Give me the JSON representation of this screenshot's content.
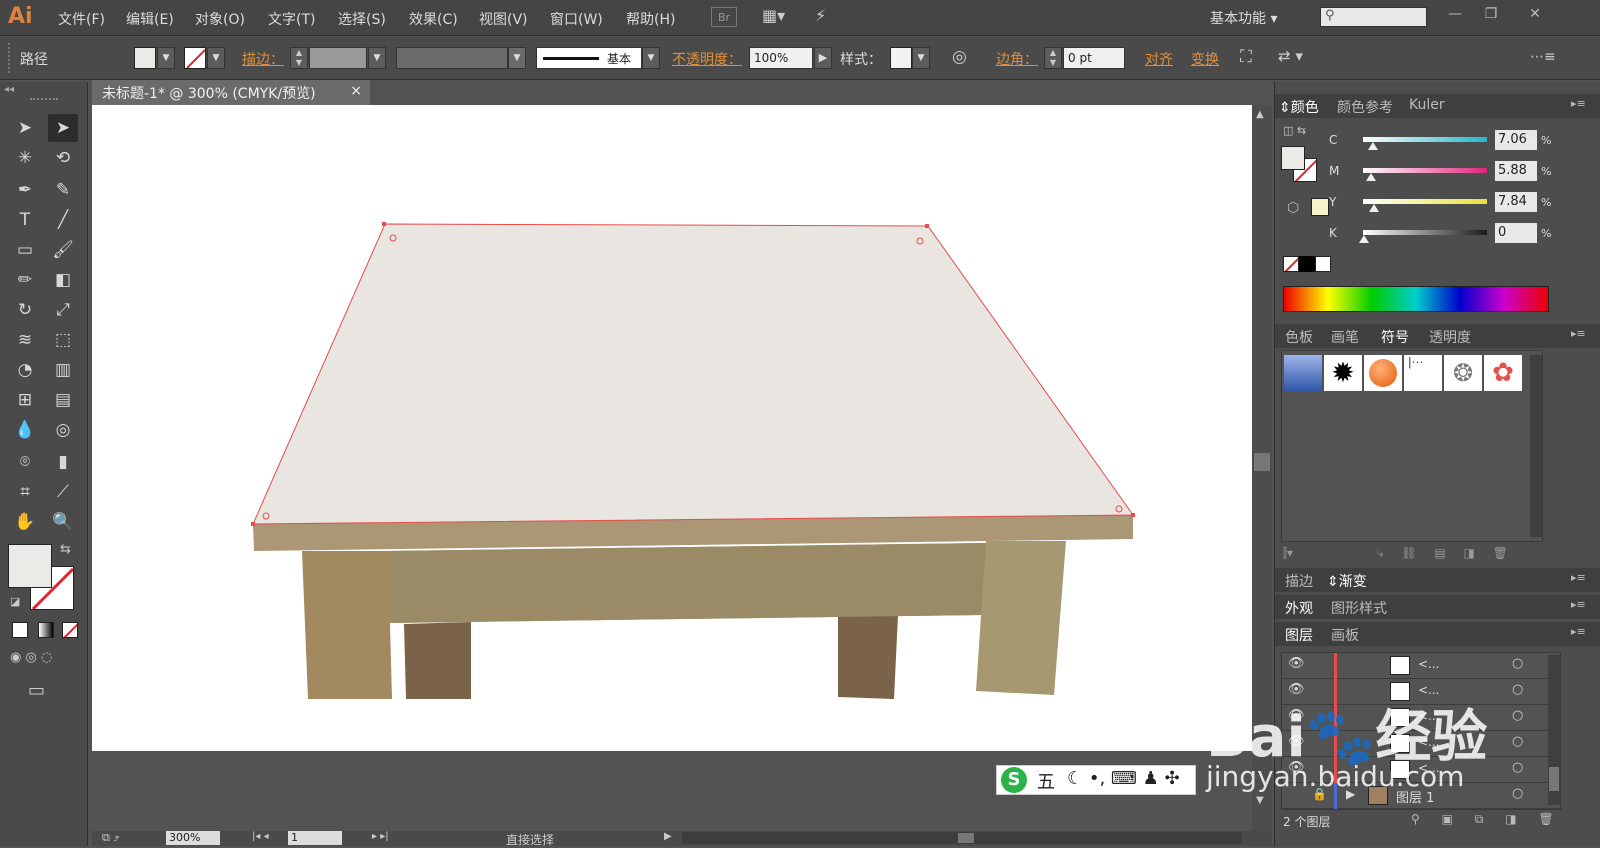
{
  "app": {
    "logo": "Ai",
    "bridge": "Br",
    "workspace": "基本功能"
  },
  "menu": [
    "文件(F)",
    "编辑(E)",
    "对象(O)",
    "文字(T)",
    "选择(S)",
    "效果(C)",
    "视图(V)",
    "窗口(W)",
    "帮助(H)"
  ],
  "control": {
    "object_type": "路径",
    "stroke_label": "描边：",
    "stroke_style": "基本",
    "opacity_label": "不透明度：",
    "opacity_value": "100%",
    "style_label": "样式：",
    "corner_label": "边角：",
    "corner_value": "0 pt",
    "align_label": "对齐",
    "transform_label": "变换"
  },
  "document": {
    "tab_title": "未标题-1* @ 300% (CMYK/预览)",
    "close": "×"
  },
  "status": {
    "zoom": "300%",
    "artboard": "1",
    "tool": "直接选择"
  },
  "color_panel": {
    "tabs": [
      "颜色",
      "颜色参考",
      "Kuler"
    ],
    "channels": [
      {
        "label": "C",
        "value": "7.06",
        "level": 0.07,
        "color": "#1fb6c9"
      },
      {
        "label": "M",
        "value": "5.88",
        "level": 0.06,
        "color": "#e0257f"
      },
      {
        "label": "Y",
        "value": "7.84",
        "level": 0.08,
        "color": "#e8e23a"
      },
      {
        "label": "K",
        "value": "0",
        "level": 0.0,
        "color": "#1a1a1a"
      }
    ],
    "percent": "%"
  },
  "swatch_panel": {
    "tabs": [
      "色板",
      "画笔",
      "符号",
      "透明度"
    ],
    "active": "符号"
  },
  "gradient_panel": {
    "tabs": [
      "描边",
      "渐变"
    ]
  },
  "appearance_panel": {
    "tabs": [
      "外观",
      "图形样式"
    ]
  },
  "layers_panel": {
    "tabs": [
      "图层",
      "画板"
    ],
    "rows": [
      "<...",
      "<...",
      "<...",
      "<...",
      "<..."
    ],
    "layer_name": "图层 1",
    "count": "2 个图层"
  },
  "watermark": {
    "brand": "Bai",
    "brand2": "经验",
    "url": "jingyan.baidu.com",
    "ime": "五"
  },
  "colors": {
    "fill": "#ece9e4",
    "selection": "#e84b4b",
    "tabletop": "#e9e6e1"
  }
}
